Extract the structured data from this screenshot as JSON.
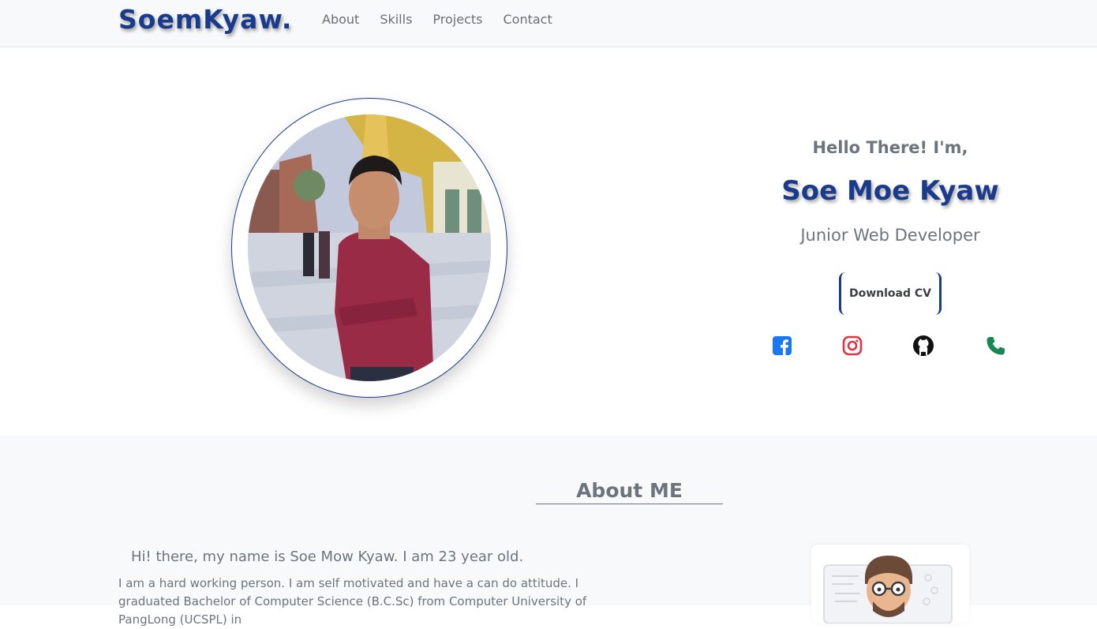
{
  "navbar": {
    "brand": "SoemKyaw.",
    "links": [
      "About",
      "Skills",
      "Projects",
      "Contact"
    ]
  },
  "hero": {
    "greeting": "Hello There! I'm,",
    "name": "Soe Moe Kyaw",
    "role": "Junior Web Developer",
    "cv_button": "Download CV",
    "socials": [
      "facebook-icon",
      "instagram-icon",
      "github-icon",
      "phone-icon"
    ],
    "colors": {
      "brand": "#1a3a8c",
      "facebook": "#1877f2",
      "instagram": "#dc3545",
      "github": "#111111",
      "phone": "#198754"
    }
  },
  "about": {
    "title": "About ME",
    "intro": "Hi! there, my name is Soe Mow Kyaw. I am 23 year old.",
    "body": "I am a hard working person. I am self motivated and have a can do attitude. I graduated Bachelor of Computer Science (B.C.Sc) from Computer University of PangLong (UCSPL) in"
  }
}
